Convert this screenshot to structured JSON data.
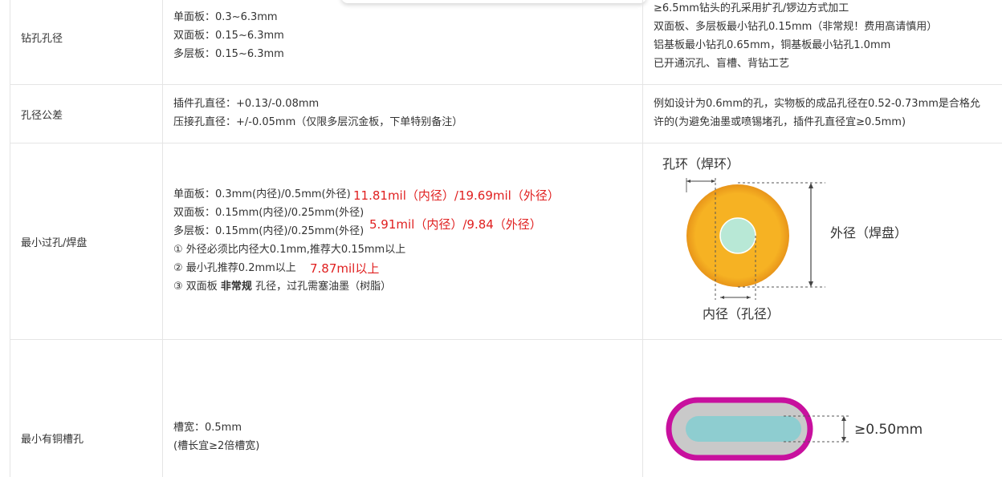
{
  "rows": [
    {
      "label": "钻孔孔径",
      "spec": [
        "单面板：0.3~6.3mm",
        "双面板：0.15~6.3mm",
        "多层板：0.15~6.3mm"
      ],
      "notes": [
        "≥6.5mm钻头的孔采用扩孔/锣边方式加工",
        "双面板、多层板最小钻孔0.15mm（非常规！费用高请慎用）",
        "铝基板最小钻孔0.65mm，铜基板最小钻孔1.0mm",
        "已开通沉孔、盲槽、背钻工艺"
      ]
    },
    {
      "label": "孔径公差",
      "spec": [
        "插件孔直径：+0.13/-0.08mm",
        "压接孔直径：+/-0.05mm（仅限多层沉金板，下单特别备注）"
      ],
      "notes": [
        "例如设计为0.6mm的孔，实物板的成品孔径在0.52-0.73mm是合格允",
        "许的(为避免油墨或喷锡堵孔，插件孔直径宜≥0.5mm)"
      ]
    },
    {
      "label": "最小过孔/焊盘",
      "spec": [
        "单面板：0.3mm(内径)/0.5mm(外径)",
        "双面板：0.15mm(内径)/0.25mm(外径)",
        "多层板：0.15mm(内径)/0.25mm(外径)",
        "① 外径必须比内径大0.1mm,推荐大0.15mm以上",
        "② 最小孔推荐0.2mm以上",
        "③ 双面板 ",
        "非常规",
        " 孔径，过孔需塞油墨（树脂）"
      ],
      "red_notes": [
        "11.81mil（内径）/19.69mil（外径）",
        "5.91mil（内径）/9.84（外径）",
        "7.87mil以上"
      ],
      "diagram": {
        "ring_label": "孔环（焊环）",
        "outer_label": "外径（焊盘）",
        "inner_label": "内径（孔径）"
      }
    },
    {
      "label": "最小有铜槽孔",
      "spec": [
        "槽宽：0.5mm",
        "(槽长宜≥2倍槽宽)"
      ],
      "diagram": {
        "dimension_label": "≥0.50mm"
      }
    }
  ],
  "colors": {
    "red_note": "#e02020",
    "pad_orange": "#f6b223",
    "pad_edge": "#e8951a",
    "hole_mint": "#b8e8d6",
    "slot_magenta": "#c8109e",
    "slot_grey": "#c9c9c9",
    "slot_teal": "#8ecdd0",
    "grid_line": "#e5e5e5"
  }
}
